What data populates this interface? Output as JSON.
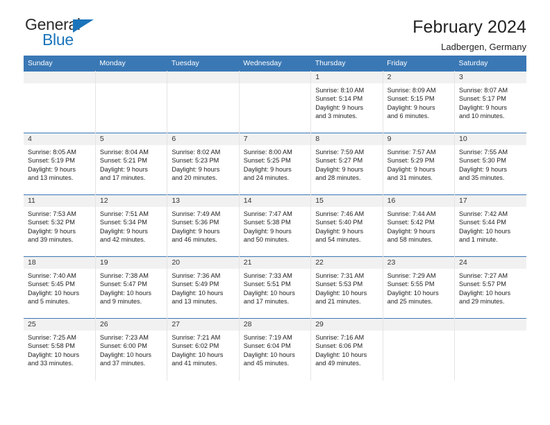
{
  "brand": {
    "name_top": "General",
    "name_bottom": "Blue",
    "accent_color": "#1a74bb",
    "triangle_icon": "triangle-icon"
  },
  "header": {
    "title": "February 2024",
    "subtitle": "Ladbergen, Germany"
  },
  "colors": {
    "header_row_bg": "#3a78b5",
    "daynum_band_bg": "#f1f1f1",
    "text": "#222222",
    "column_divider": "#e4e4e4"
  },
  "weekdays": [
    "Sunday",
    "Monday",
    "Tuesday",
    "Wednesday",
    "Thursday",
    "Friday",
    "Saturday"
  ],
  "weeks": [
    [
      {
        "day": "",
        "sunrise": "",
        "sunset": "",
        "daylight_line1": "",
        "daylight_line2": "",
        "empty": true
      },
      {
        "day": "",
        "sunrise": "",
        "sunset": "",
        "daylight_line1": "",
        "daylight_line2": "",
        "empty": true
      },
      {
        "day": "",
        "sunrise": "",
        "sunset": "",
        "daylight_line1": "",
        "daylight_line2": "",
        "empty": true
      },
      {
        "day": "",
        "sunrise": "",
        "sunset": "",
        "daylight_line1": "",
        "daylight_line2": "",
        "empty": true
      },
      {
        "day": "1",
        "sunrise": "Sunrise: 8:10 AM",
        "sunset": "Sunset: 5:14 PM",
        "daylight_line1": "Daylight: 9 hours",
        "daylight_line2": "and 3 minutes."
      },
      {
        "day": "2",
        "sunrise": "Sunrise: 8:09 AM",
        "sunset": "Sunset: 5:15 PM",
        "daylight_line1": "Daylight: 9 hours",
        "daylight_line2": "and 6 minutes."
      },
      {
        "day": "3",
        "sunrise": "Sunrise: 8:07 AM",
        "sunset": "Sunset: 5:17 PM",
        "daylight_line1": "Daylight: 9 hours",
        "daylight_line2": "and 10 minutes."
      }
    ],
    [
      {
        "day": "4",
        "sunrise": "Sunrise: 8:05 AM",
        "sunset": "Sunset: 5:19 PM",
        "daylight_line1": "Daylight: 9 hours",
        "daylight_line2": "and 13 minutes."
      },
      {
        "day": "5",
        "sunrise": "Sunrise: 8:04 AM",
        "sunset": "Sunset: 5:21 PM",
        "daylight_line1": "Daylight: 9 hours",
        "daylight_line2": "and 17 minutes."
      },
      {
        "day": "6",
        "sunrise": "Sunrise: 8:02 AM",
        "sunset": "Sunset: 5:23 PM",
        "daylight_line1": "Daylight: 9 hours",
        "daylight_line2": "and 20 minutes."
      },
      {
        "day": "7",
        "sunrise": "Sunrise: 8:00 AM",
        "sunset": "Sunset: 5:25 PM",
        "daylight_line1": "Daylight: 9 hours",
        "daylight_line2": "and 24 minutes."
      },
      {
        "day": "8",
        "sunrise": "Sunrise: 7:59 AM",
        "sunset": "Sunset: 5:27 PM",
        "daylight_line1": "Daylight: 9 hours",
        "daylight_line2": "and 28 minutes."
      },
      {
        "day": "9",
        "sunrise": "Sunrise: 7:57 AM",
        "sunset": "Sunset: 5:29 PM",
        "daylight_line1": "Daylight: 9 hours",
        "daylight_line2": "and 31 minutes."
      },
      {
        "day": "10",
        "sunrise": "Sunrise: 7:55 AM",
        "sunset": "Sunset: 5:30 PM",
        "daylight_line1": "Daylight: 9 hours",
        "daylight_line2": "and 35 minutes."
      }
    ],
    [
      {
        "day": "11",
        "sunrise": "Sunrise: 7:53 AM",
        "sunset": "Sunset: 5:32 PM",
        "daylight_line1": "Daylight: 9 hours",
        "daylight_line2": "and 39 minutes."
      },
      {
        "day": "12",
        "sunrise": "Sunrise: 7:51 AM",
        "sunset": "Sunset: 5:34 PM",
        "daylight_line1": "Daylight: 9 hours",
        "daylight_line2": "and 42 minutes."
      },
      {
        "day": "13",
        "sunrise": "Sunrise: 7:49 AM",
        "sunset": "Sunset: 5:36 PM",
        "daylight_line1": "Daylight: 9 hours",
        "daylight_line2": "and 46 minutes."
      },
      {
        "day": "14",
        "sunrise": "Sunrise: 7:47 AM",
        "sunset": "Sunset: 5:38 PM",
        "daylight_line1": "Daylight: 9 hours",
        "daylight_line2": "and 50 minutes."
      },
      {
        "day": "15",
        "sunrise": "Sunrise: 7:46 AM",
        "sunset": "Sunset: 5:40 PM",
        "daylight_line1": "Daylight: 9 hours",
        "daylight_line2": "and 54 minutes."
      },
      {
        "day": "16",
        "sunrise": "Sunrise: 7:44 AM",
        "sunset": "Sunset: 5:42 PM",
        "daylight_line1": "Daylight: 9 hours",
        "daylight_line2": "and 58 minutes."
      },
      {
        "day": "17",
        "sunrise": "Sunrise: 7:42 AM",
        "sunset": "Sunset: 5:44 PM",
        "daylight_line1": "Daylight: 10 hours",
        "daylight_line2": "and 1 minute."
      }
    ],
    [
      {
        "day": "18",
        "sunrise": "Sunrise: 7:40 AM",
        "sunset": "Sunset: 5:45 PM",
        "daylight_line1": "Daylight: 10 hours",
        "daylight_line2": "and 5 minutes."
      },
      {
        "day": "19",
        "sunrise": "Sunrise: 7:38 AM",
        "sunset": "Sunset: 5:47 PM",
        "daylight_line1": "Daylight: 10 hours",
        "daylight_line2": "and 9 minutes."
      },
      {
        "day": "20",
        "sunrise": "Sunrise: 7:36 AM",
        "sunset": "Sunset: 5:49 PM",
        "daylight_line1": "Daylight: 10 hours",
        "daylight_line2": "and 13 minutes."
      },
      {
        "day": "21",
        "sunrise": "Sunrise: 7:33 AM",
        "sunset": "Sunset: 5:51 PM",
        "daylight_line1": "Daylight: 10 hours",
        "daylight_line2": "and 17 minutes."
      },
      {
        "day": "22",
        "sunrise": "Sunrise: 7:31 AM",
        "sunset": "Sunset: 5:53 PM",
        "daylight_line1": "Daylight: 10 hours",
        "daylight_line2": "and 21 minutes."
      },
      {
        "day": "23",
        "sunrise": "Sunrise: 7:29 AM",
        "sunset": "Sunset: 5:55 PM",
        "daylight_line1": "Daylight: 10 hours",
        "daylight_line2": "and 25 minutes."
      },
      {
        "day": "24",
        "sunrise": "Sunrise: 7:27 AM",
        "sunset": "Sunset: 5:57 PM",
        "daylight_line1": "Daylight: 10 hours",
        "daylight_line2": "and 29 minutes."
      }
    ],
    [
      {
        "day": "25",
        "sunrise": "Sunrise: 7:25 AM",
        "sunset": "Sunset: 5:58 PM",
        "daylight_line1": "Daylight: 10 hours",
        "daylight_line2": "and 33 minutes."
      },
      {
        "day": "26",
        "sunrise": "Sunrise: 7:23 AM",
        "sunset": "Sunset: 6:00 PM",
        "daylight_line1": "Daylight: 10 hours",
        "daylight_line2": "and 37 minutes."
      },
      {
        "day": "27",
        "sunrise": "Sunrise: 7:21 AM",
        "sunset": "Sunset: 6:02 PM",
        "daylight_line1": "Daylight: 10 hours",
        "daylight_line2": "and 41 minutes."
      },
      {
        "day": "28",
        "sunrise": "Sunrise: 7:19 AM",
        "sunset": "Sunset: 6:04 PM",
        "daylight_line1": "Daylight: 10 hours",
        "daylight_line2": "and 45 minutes."
      },
      {
        "day": "29",
        "sunrise": "Sunrise: 7:16 AM",
        "sunset": "Sunset: 6:06 PM",
        "daylight_line1": "Daylight: 10 hours",
        "daylight_line2": "and 49 minutes."
      },
      {
        "day": "",
        "sunrise": "",
        "sunset": "",
        "daylight_line1": "",
        "daylight_line2": "",
        "empty": true
      },
      {
        "day": "",
        "sunrise": "",
        "sunset": "",
        "daylight_line1": "",
        "daylight_line2": "",
        "empty": true
      }
    ]
  ]
}
